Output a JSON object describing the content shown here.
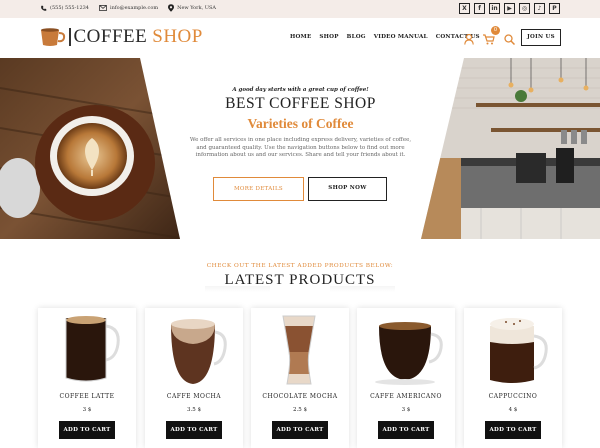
{
  "topbar": {
    "phone": "(555) 555-1234",
    "email": "info@example.com",
    "location": "New York, USA",
    "social": [
      "X",
      "f",
      "in",
      "▶",
      "◎",
      "♪",
      "P"
    ]
  },
  "logo": {
    "part1": "COFFEE",
    "part2": "SHOP"
  },
  "nav": [
    "HOME",
    "SHOP",
    "BLOG",
    "VIDEO MANUAL",
    "CONTACT US"
  ],
  "cart_count": "0",
  "join": "JOIN US",
  "hero": {
    "tagline": "A good day starts with a great cup of coffee!",
    "title": "BEST COFFEE SHOP",
    "subtitle": "Varieties of Coffee",
    "description": "We offer all services in one place including express delivery, varieties of coffee, and guaranteed quality. Use the navigation buttons below to find out more information about us and our services. Share and tell your friends about it.",
    "btn_details": "MORE DETAILS",
    "btn_shop": "SHOP NOW"
  },
  "products_section": {
    "subtitle": "CHECK OUT THE LATEST ADDED PRODUCTS BELOW:",
    "title": "LATEST PRODUCTS"
  },
  "products": [
    {
      "name": "COFFEE LATTE",
      "price": "3 $",
      "cart": "ADD TO CART"
    },
    {
      "name": "CAFFE MOCHA",
      "price": "3.5 $",
      "cart": "ADD TO CART"
    },
    {
      "name": "CHOCOLATE MOCHA",
      "price": "2.5 $",
      "cart": "ADD TO CART"
    },
    {
      "name": "CAFFE AMERICANO",
      "price": "3 $",
      "cart": "ADD TO CART"
    },
    {
      "name": "CAPPUCCINO",
      "price": "4 $",
      "cart": "ADD TO CART"
    }
  ],
  "colors": {
    "accent": "#e08a3a",
    "dark": "#111111",
    "topbar": "#f4ece8"
  }
}
